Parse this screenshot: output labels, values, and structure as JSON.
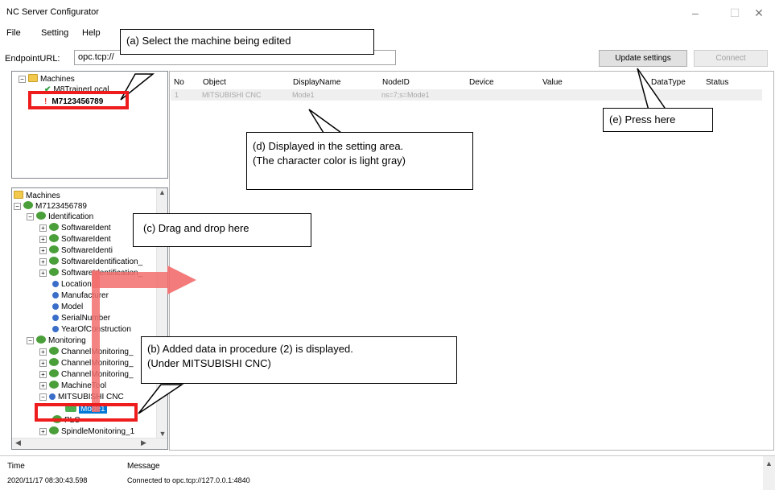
{
  "window": {
    "title": "NC Server Configurator",
    "controls": {
      "minimize": "–",
      "maximize": "☐",
      "close": "✕"
    }
  },
  "menu": [
    "File",
    "Setting",
    "Help"
  ],
  "endpoint": {
    "label": "EndpointURL:",
    "value": "opc.tcp://"
  },
  "buttons": {
    "update": "Update settings",
    "connect": "Connect"
  },
  "top_tree": {
    "root": "Machines",
    "items": [
      "M8TrainerLocal",
      "M7123456789"
    ]
  },
  "grid": {
    "columns": [
      "No",
      "Object",
      "DisplayName",
      "NodeID",
      "Device",
      "Value",
      "DataType",
      "Status"
    ],
    "rows": [
      {
        "no": "1",
        "object": "MITSUBISHI CNC",
        "display_name": "Mode1",
        "node_id": "ns=7;s=Mode1"
      }
    ]
  },
  "tree": {
    "root": "Machines",
    "machine": "M7123456789",
    "identification": "Identification",
    "id_children": [
      "SoftwareIdent",
      "SoftwareIdent",
      "SoftwareIdenti",
      "SoftwareIdentification_",
      "SoftwareIdentification_",
      "Location",
      "Manufacturer",
      "Model",
      "SerialNumber",
      "YearOfConstruction"
    ],
    "monitoring": "Monitoring",
    "mon_children": [
      "ChannelMonitoring_",
      "ChannelMonitoring_",
      "ChannelMonitoring_",
      "MachineTool",
      "MITSUBISHI CNC"
    ],
    "selected": "Mode1",
    "after": [
      "PLC",
      "SpindleMonitoring_1"
    ]
  },
  "log": {
    "headers": [
      "Time",
      "Message"
    ],
    "rows": [
      {
        "time": "2020/11/17 08:30:43.598",
        "message": "Connected to opc.tcp://127.0.0.1:4840"
      }
    ]
  },
  "callouts": {
    "a": "(a) Select the machine being edited",
    "b1": "(b) Added data in procedure (2) is displayed.",
    "b2": "(Under MITSUBISHI CNC)",
    "c": "(c) Drag and drop here",
    "d1": "(d) Displayed in the setting area.",
    "d2": "(The character color is light gray)",
    "e": "(e) Press here"
  },
  "colors": {
    "highlight_red": "#ee1c1c",
    "selection_blue": "#0078d7",
    "arrow_red": "#f26d6d"
  }
}
